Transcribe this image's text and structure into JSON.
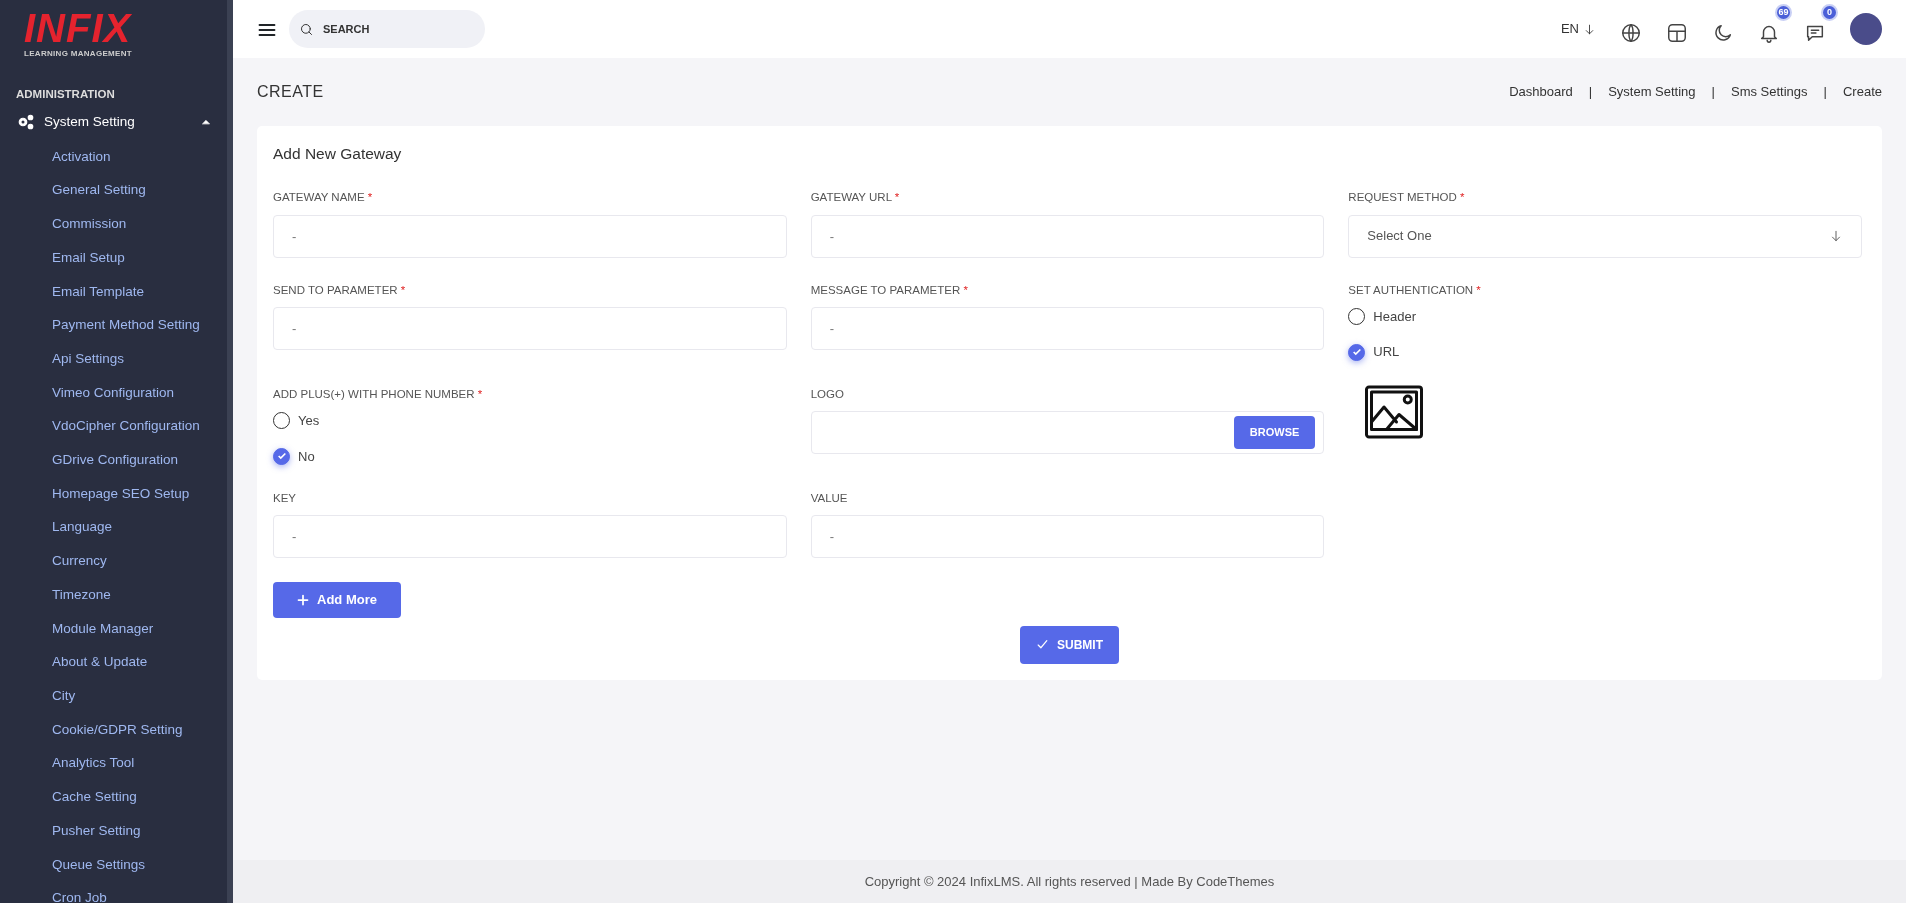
{
  "logo": {
    "brand": "INFIX",
    "tagline": "LEARNING MANAGEMENT"
  },
  "sidebar": {
    "section": "ADMINISTRATION",
    "group": {
      "label": "System Setting",
      "expanded": true,
      "items": [
        {
          "label": "Activation"
        },
        {
          "label": "General Setting"
        },
        {
          "label": "Commission"
        },
        {
          "label": "Email Setup"
        },
        {
          "label": "Email Template"
        },
        {
          "label": "Payment Method Setting"
        },
        {
          "label": "Api Settings"
        },
        {
          "label": "Vimeo Configuration"
        },
        {
          "label": "VdoCipher Configuration"
        },
        {
          "label": "GDrive Configuration"
        },
        {
          "label": "Homepage SEO Setup"
        },
        {
          "label": "Language"
        },
        {
          "label": "Currency"
        },
        {
          "label": "Timezone"
        },
        {
          "label": "Module Manager"
        },
        {
          "label": "About & Update"
        },
        {
          "label": "City"
        },
        {
          "label": "Cookie/GDPR Setting"
        },
        {
          "label": "Analytics Tool"
        },
        {
          "label": "Cache Setting"
        },
        {
          "label": "Pusher Setting"
        },
        {
          "label": "Queue Settings"
        },
        {
          "label": "Cron Job"
        }
      ]
    }
  },
  "header": {
    "search": {
      "placeholder": "SEARCH"
    },
    "language": "EN",
    "notifications_count": "69",
    "messages_count": "0"
  },
  "page": {
    "title": "CREATE",
    "breadcrumbs": {
      "separator": "|",
      "items": [
        "Dashboard",
        "System Setting",
        "Sms Settings",
        "Create"
      ]
    }
  },
  "form": {
    "title": "Add New Gateway",
    "rows": [
      [
        {
          "kind": "text",
          "label": "GATEWAY NAME",
          "required": true,
          "placeholder": "-"
        },
        {
          "kind": "text",
          "label": "GATEWAY URL",
          "required": true,
          "placeholder": "-"
        },
        {
          "kind": "select",
          "label": "REQUEST METHOD",
          "required": true,
          "value": "Select One"
        }
      ],
      [
        {
          "kind": "text",
          "label": "SEND TO PARAMETER",
          "required": true,
          "placeholder": "-"
        },
        {
          "kind": "text",
          "label": "MESSAGE TO PARAMETER",
          "required": true,
          "placeholder": "-"
        },
        {
          "kind": "radio",
          "label": "SET AUTHENTICATION",
          "required": true,
          "options": [
            {
              "label": "Header",
              "selected": false
            },
            {
              "label": "URL",
              "selected": true
            }
          ]
        }
      ],
      [
        {
          "kind": "radio",
          "label": "ADD PLUS(+) WITH PHONE NUMBER",
          "required": true,
          "options": [
            {
              "label": "Yes",
              "selected": false
            },
            {
              "label": "No",
              "selected": true
            }
          ]
        },
        {
          "kind": "file",
          "label": "LOGO",
          "required": false,
          "button": "BROWSE"
        },
        {
          "kind": "image"
        }
      ],
      [
        {
          "kind": "text",
          "label": "KEY",
          "required": false,
          "placeholder": "-"
        },
        {
          "kind": "text",
          "label": "VALUE",
          "required": false,
          "placeholder": "-"
        }
      ]
    ],
    "required_mark": "*",
    "add_more": "Add More",
    "submit": "SUBMIT"
  },
  "footer": "Copyright © 2024 InfixLMS. All rights reserved | Made By CodeThemes"
}
